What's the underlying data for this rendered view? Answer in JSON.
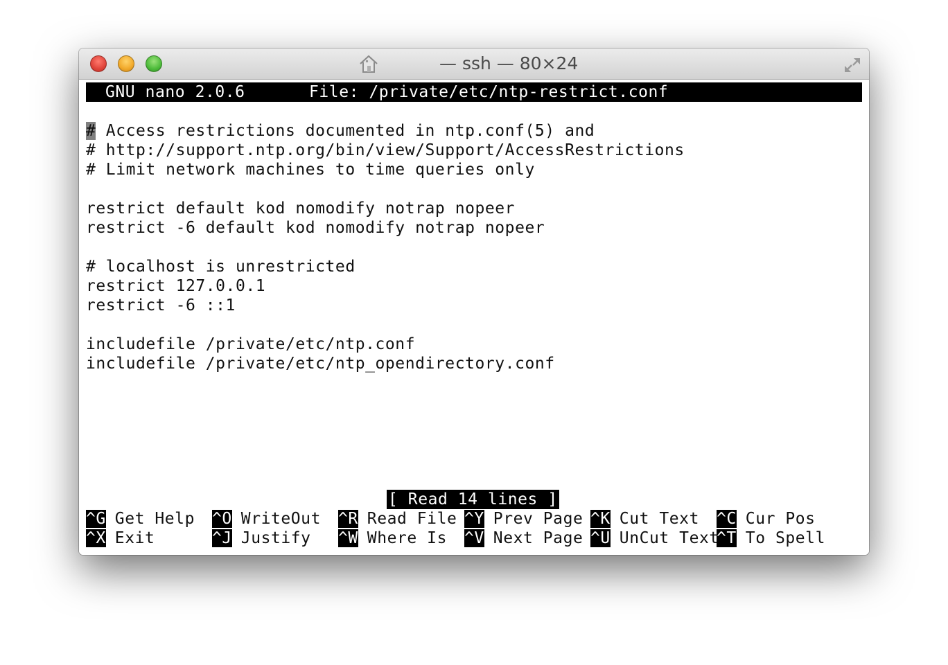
{
  "window": {
    "title": "— ssh — 80×24"
  },
  "nano": {
    "version": "GNU nano 2.0.6",
    "file": "File: /private/etc/ntp-restrict.conf",
    "cursor_char": "#",
    "first_line_rest": " Access restrictions documented in ntp.conf(5) and",
    "lines": [
      "# http://support.ntp.org/bin/view/Support/AccessRestrictions",
      "# Limit network machines to time queries only",
      "",
      "restrict default kod nomodify notrap nopeer",
      "restrict -6 default kod nomodify notrap nopeer",
      "",
      "# localhost is unrestricted",
      "restrict 127.0.0.1",
      "restrict -6 ::1",
      "",
      "includefile /private/etc/ntp.conf",
      "includefile /private/etc/ntp_opendirectory.conf"
    ],
    "status": "[ Read 14 lines ]",
    "shortcuts": [
      {
        "key": "^G",
        "label": "Get Help"
      },
      {
        "key": "^O",
        "label": "WriteOut"
      },
      {
        "key": "^R",
        "label": "Read File"
      },
      {
        "key": "^Y",
        "label": "Prev Page"
      },
      {
        "key": "^K",
        "label": "Cut Text"
      },
      {
        "key": "^C",
        "label": "Cur Pos"
      },
      {
        "key": "^X",
        "label": "Exit"
      },
      {
        "key": "^J",
        "label": "Justify"
      },
      {
        "key": "^W",
        "label": "Where Is"
      },
      {
        "key": "^V",
        "label": "Next Page"
      },
      {
        "key": "^U",
        "label": "UnCut Text"
      },
      {
        "key": "^T",
        "label": "To Spell"
      }
    ]
  },
  "colors": {
    "terminal_bg": "#ffffff",
    "terminal_fg": "#111111",
    "inverse_bg": "#000000",
    "cursor": "#808080"
  }
}
